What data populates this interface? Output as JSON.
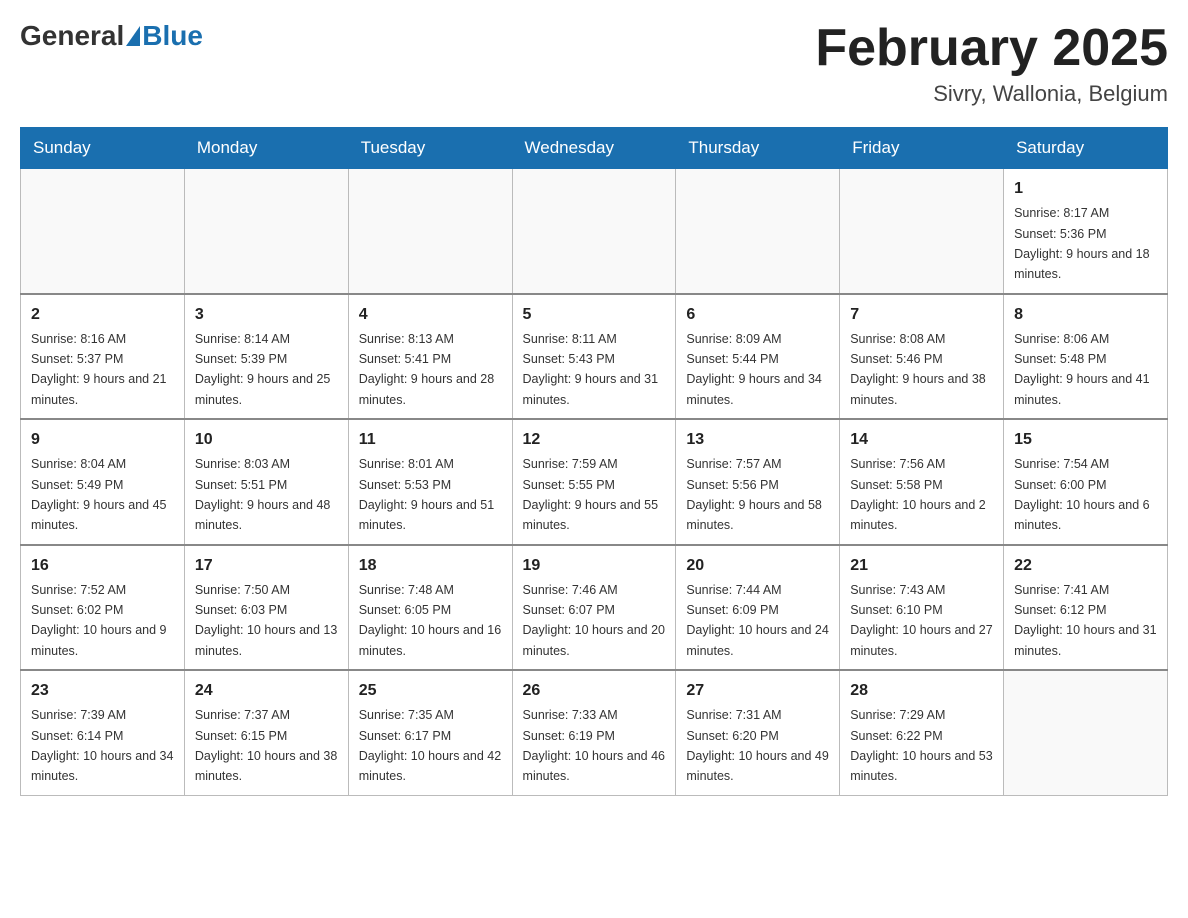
{
  "header": {
    "logo_general": "General",
    "logo_blue": "Blue",
    "title": "February 2025",
    "location": "Sivry, Wallonia, Belgium"
  },
  "weekdays": [
    "Sunday",
    "Monday",
    "Tuesday",
    "Wednesday",
    "Thursday",
    "Friday",
    "Saturday"
  ],
  "weeks": [
    [
      null,
      null,
      null,
      null,
      null,
      null,
      {
        "day": "1",
        "sunrise": "Sunrise: 8:17 AM",
        "sunset": "Sunset: 5:36 PM",
        "daylight": "Daylight: 9 hours and 18 minutes."
      }
    ],
    [
      {
        "day": "2",
        "sunrise": "Sunrise: 8:16 AM",
        "sunset": "Sunset: 5:37 PM",
        "daylight": "Daylight: 9 hours and 21 minutes."
      },
      {
        "day": "3",
        "sunrise": "Sunrise: 8:14 AM",
        "sunset": "Sunset: 5:39 PM",
        "daylight": "Daylight: 9 hours and 25 minutes."
      },
      {
        "day": "4",
        "sunrise": "Sunrise: 8:13 AM",
        "sunset": "Sunset: 5:41 PM",
        "daylight": "Daylight: 9 hours and 28 minutes."
      },
      {
        "day": "5",
        "sunrise": "Sunrise: 8:11 AM",
        "sunset": "Sunset: 5:43 PM",
        "daylight": "Daylight: 9 hours and 31 minutes."
      },
      {
        "day": "6",
        "sunrise": "Sunrise: 8:09 AM",
        "sunset": "Sunset: 5:44 PM",
        "daylight": "Daylight: 9 hours and 34 minutes."
      },
      {
        "day": "7",
        "sunrise": "Sunrise: 8:08 AM",
        "sunset": "Sunset: 5:46 PM",
        "daylight": "Daylight: 9 hours and 38 minutes."
      },
      {
        "day": "8",
        "sunrise": "Sunrise: 8:06 AM",
        "sunset": "Sunset: 5:48 PM",
        "daylight": "Daylight: 9 hours and 41 minutes."
      }
    ],
    [
      {
        "day": "9",
        "sunrise": "Sunrise: 8:04 AM",
        "sunset": "Sunset: 5:49 PM",
        "daylight": "Daylight: 9 hours and 45 minutes."
      },
      {
        "day": "10",
        "sunrise": "Sunrise: 8:03 AM",
        "sunset": "Sunset: 5:51 PM",
        "daylight": "Daylight: 9 hours and 48 minutes."
      },
      {
        "day": "11",
        "sunrise": "Sunrise: 8:01 AM",
        "sunset": "Sunset: 5:53 PM",
        "daylight": "Daylight: 9 hours and 51 minutes."
      },
      {
        "day": "12",
        "sunrise": "Sunrise: 7:59 AM",
        "sunset": "Sunset: 5:55 PM",
        "daylight": "Daylight: 9 hours and 55 minutes."
      },
      {
        "day": "13",
        "sunrise": "Sunrise: 7:57 AM",
        "sunset": "Sunset: 5:56 PM",
        "daylight": "Daylight: 9 hours and 58 minutes."
      },
      {
        "day": "14",
        "sunrise": "Sunrise: 7:56 AM",
        "sunset": "Sunset: 5:58 PM",
        "daylight": "Daylight: 10 hours and 2 minutes."
      },
      {
        "day": "15",
        "sunrise": "Sunrise: 7:54 AM",
        "sunset": "Sunset: 6:00 PM",
        "daylight": "Daylight: 10 hours and 6 minutes."
      }
    ],
    [
      {
        "day": "16",
        "sunrise": "Sunrise: 7:52 AM",
        "sunset": "Sunset: 6:02 PM",
        "daylight": "Daylight: 10 hours and 9 minutes."
      },
      {
        "day": "17",
        "sunrise": "Sunrise: 7:50 AM",
        "sunset": "Sunset: 6:03 PM",
        "daylight": "Daylight: 10 hours and 13 minutes."
      },
      {
        "day": "18",
        "sunrise": "Sunrise: 7:48 AM",
        "sunset": "Sunset: 6:05 PM",
        "daylight": "Daylight: 10 hours and 16 minutes."
      },
      {
        "day": "19",
        "sunrise": "Sunrise: 7:46 AM",
        "sunset": "Sunset: 6:07 PM",
        "daylight": "Daylight: 10 hours and 20 minutes."
      },
      {
        "day": "20",
        "sunrise": "Sunrise: 7:44 AM",
        "sunset": "Sunset: 6:09 PM",
        "daylight": "Daylight: 10 hours and 24 minutes."
      },
      {
        "day": "21",
        "sunrise": "Sunrise: 7:43 AM",
        "sunset": "Sunset: 6:10 PM",
        "daylight": "Daylight: 10 hours and 27 minutes."
      },
      {
        "day": "22",
        "sunrise": "Sunrise: 7:41 AM",
        "sunset": "Sunset: 6:12 PM",
        "daylight": "Daylight: 10 hours and 31 minutes."
      }
    ],
    [
      {
        "day": "23",
        "sunrise": "Sunrise: 7:39 AM",
        "sunset": "Sunset: 6:14 PM",
        "daylight": "Daylight: 10 hours and 34 minutes."
      },
      {
        "day": "24",
        "sunrise": "Sunrise: 7:37 AM",
        "sunset": "Sunset: 6:15 PM",
        "daylight": "Daylight: 10 hours and 38 minutes."
      },
      {
        "day": "25",
        "sunrise": "Sunrise: 7:35 AM",
        "sunset": "Sunset: 6:17 PM",
        "daylight": "Daylight: 10 hours and 42 minutes."
      },
      {
        "day": "26",
        "sunrise": "Sunrise: 7:33 AM",
        "sunset": "Sunset: 6:19 PM",
        "daylight": "Daylight: 10 hours and 46 minutes."
      },
      {
        "day": "27",
        "sunrise": "Sunrise: 7:31 AM",
        "sunset": "Sunset: 6:20 PM",
        "daylight": "Daylight: 10 hours and 49 minutes."
      },
      {
        "day": "28",
        "sunrise": "Sunrise: 7:29 AM",
        "sunset": "Sunset: 6:22 PM",
        "daylight": "Daylight: 10 hours and 53 minutes."
      },
      null
    ]
  ]
}
